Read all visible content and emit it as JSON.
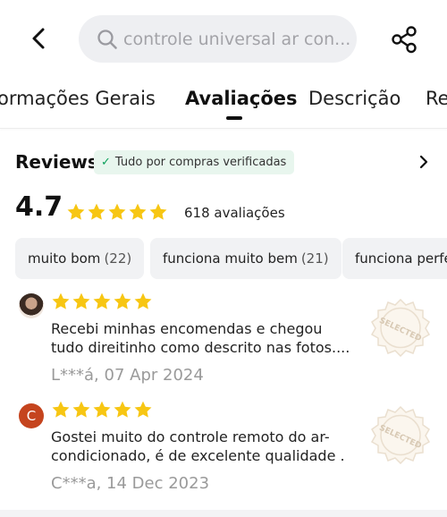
{
  "search": {
    "placeholder": "controle universal ar con..."
  },
  "tabs": [
    {
      "label": "ormações Gerais"
    },
    {
      "label": "Avaliações"
    },
    {
      "label": "Descrição"
    },
    {
      "label": "Re"
    }
  ],
  "reviews_section": {
    "title": "Reviews",
    "verified_label": "Tudo por compras verificadas",
    "rating": "4.7",
    "stars": 5,
    "count_label": "618 avaliações"
  },
  "chips": [
    {
      "label": "muito bom",
      "count": "(22)"
    },
    {
      "label": "funciona muito bem",
      "count": "(21)"
    },
    {
      "label": "funciona perfe",
      "count": ""
    }
  ],
  "reviews": [
    {
      "avatar": "",
      "stars": 5,
      "text": "Recebi minhas encomendas e chegou tudo direitinho como descrito nas fotos....",
      "meta": "L***á, 07 Apr 2024",
      "stamp": "SELECTED"
    },
    {
      "avatar": "C",
      "stars": 5,
      "text": "Gostei muito do controle remoto do ar-condicionado, é de excelente qualidade .",
      "meta": "C***a, 14 Dec 2023",
      "stamp": "SELECTED"
    }
  ],
  "colors": {
    "star": "#f7c613",
    "verified_bg": "#e8f6ee",
    "verified_check": "#0a9f5a",
    "avatar_letter_bg": "#c5441e"
  }
}
